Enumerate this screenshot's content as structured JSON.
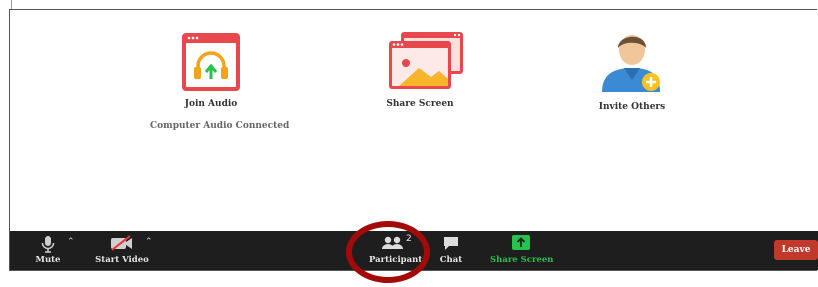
{
  "actions": {
    "join_audio": {
      "label": "Join Audio",
      "status": "Computer Audio Connected"
    },
    "share_screen": {
      "label": "Share Screen"
    },
    "invite_others": {
      "label": "Invite Others"
    }
  },
  "toolbar": {
    "mute_label": "Mute",
    "start_video_label": "Start Video",
    "participants_label": "Participants",
    "participants_count": "2",
    "chat_label": "Chat",
    "share_screen_label": "Share Screen",
    "leave_label": "Leave"
  },
  "colors": {
    "accent_red": "#e8474b",
    "share_green": "#27c24c",
    "toolbar_bg": "#1e1e1e",
    "leave_red": "#c0392b",
    "highlight_ring": "#a30b0b"
  },
  "annotation": {
    "highlighted_control": "participants-button"
  }
}
